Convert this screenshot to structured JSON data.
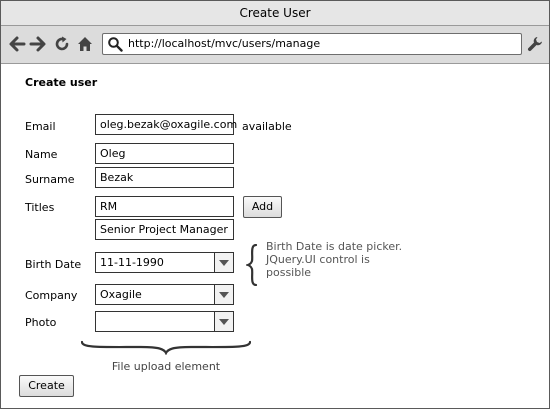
{
  "window": {
    "title": "Create User"
  },
  "browser": {
    "url": "http://localhost/mvc/users/manage",
    "icons": [
      "back-arrow-icon",
      "forward-arrow-icon",
      "refresh-icon",
      "home-icon",
      "search-icon",
      "wrench-icon"
    ]
  },
  "form": {
    "heading": "Create user",
    "email": {
      "label": "Email",
      "value": "oleg.bezak@oxagile.com",
      "status": "available"
    },
    "name": {
      "label": "Name",
      "value": "Oleg"
    },
    "surname": {
      "label": "Surname",
      "value": "Bezak"
    },
    "titles": {
      "label": "Titles",
      "values": [
        "RM",
        "Senior Project Manager"
      ],
      "add_label": "Add"
    },
    "birth_date": {
      "label": "Birth Date",
      "value": "11-11-1990"
    },
    "company": {
      "label": "Company",
      "value": "Oxagile"
    },
    "photo": {
      "label": "Photo",
      "value": ""
    },
    "create_label": "Create"
  },
  "annotations": {
    "birth_date_note": "Birth Date is date picker. JQuery.UI control is possible",
    "upload_note": "File upload element"
  }
}
